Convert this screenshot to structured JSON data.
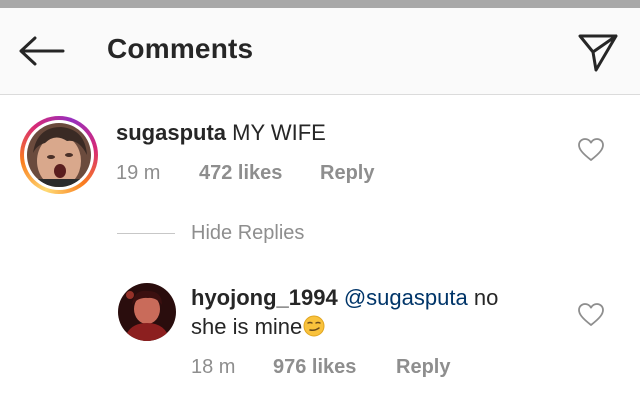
{
  "header": {
    "title": "Comments",
    "back_icon": "arrow-left-icon",
    "share_icon": "direct-send-icon"
  },
  "comments": [
    {
      "username": "sugasputa",
      "text": "MY WIFE",
      "time": "19 m",
      "likes": "472 likes",
      "reply_label": "Reply",
      "liked": false
    }
  ],
  "hide_replies_label": "Hide Replies",
  "replies": [
    {
      "username": "hyojong_1994",
      "mention": "@sugasputa",
      "text_line1": "no",
      "text_line2": "she is mine",
      "emoji": "smirk-emoji",
      "time": "18 m",
      "likes": "976 likes",
      "reply_label": "Reply",
      "liked": false
    }
  ],
  "colors": {
    "text": "#262626",
    "secondary": "#8e8e8e",
    "mention": "#003569",
    "header_bg": "#fafafa",
    "story_ring": "#d62976"
  }
}
